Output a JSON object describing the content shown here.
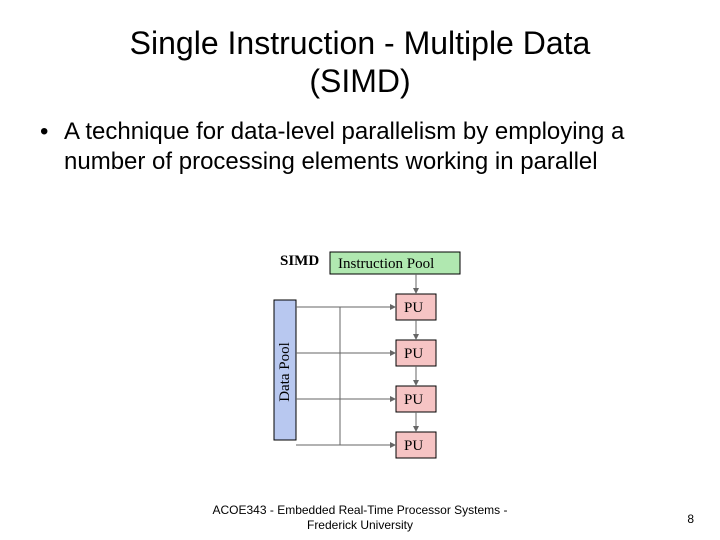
{
  "title_line1": "Single Instruction - Multiple Data",
  "title_line2": "(SIMD)",
  "bullet1": "A technique for data-level parallelism by employing a number of processing elements working in parallel",
  "diagram": {
    "simd_label": "SIMD",
    "instruction_pool": "Instruction Pool",
    "data_pool": "Data Pool",
    "pu": "PU"
  },
  "footer_line1": "ACOE343 - Embedded Real-Time Processor Systems -",
  "footer_line2": "Frederick University",
  "page_number": "8"
}
